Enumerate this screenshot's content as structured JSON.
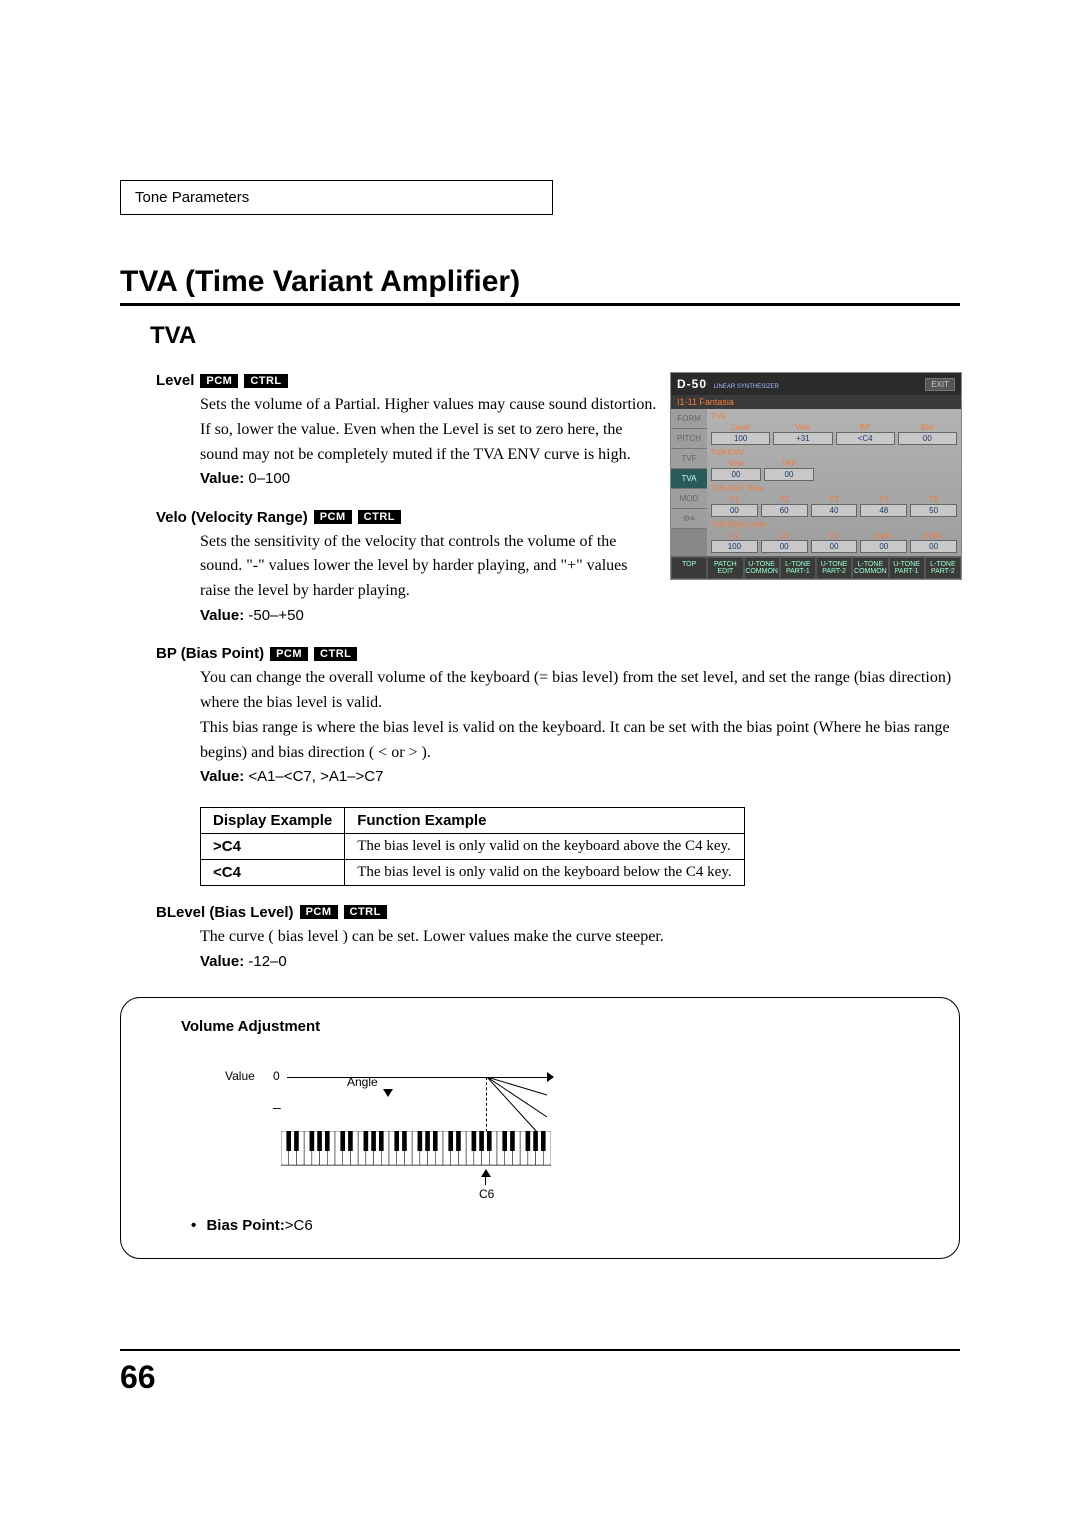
{
  "header": {
    "section": "Tone Parameters"
  },
  "title": "TVA (Time Variant Amplifier)",
  "subtitle": "TVA",
  "tags": {
    "pcm": "PCM",
    "ctrl": "CTRL"
  },
  "level": {
    "label": "Level",
    "desc": "Sets the volume of a Partial. Higher values may cause sound distortion. If so, lower the value. Even when the Level is set to zero here, the sound may not be completely muted if the TVA ENV curve is high.",
    "value_label": "Value:",
    "value": "0–100"
  },
  "velo": {
    "label": "Velo (Velocity Range)",
    "desc": "Sets the sensitivity of the velocity that controls the volume of the sound. \"-\" values lower the level by harder playing, and \"+\" values raise the level by harder playing.",
    "value_label": "Value:",
    "value": "-50–+50"
  },
  "bp": {
    "label": "BP (Bias Point)",
    "desc1": "You can change the overall volume of the keyboard (= bias level) from the set level, and set the range (bias direction) where the bias level is valid.",
    "desc2": "This bias range is where the bias level is valid on the keyboard. It can be set with the bias point (Where he bias range begins) and bias direction ( < or > ).",
    "value_label": "Value:",
    "value": "<A1–<C7, >A1–>C7"
  },
  "table": {
    "head1": "Display Example",
    "head2": "Function Example",
    "rows": [
      {
        "disp": ">C4",
        "func": "The bias level is only valid on the keyboard above the C4 key."
      },
      {
        "disp": "<C4",
        "func": "The bias level is only valid on the keyboard below the C4 key."
      }
    ]
  },
  "blevel": {
    "label": "BLevel (Bias Level)",
    "desc": "The curve ( bias level ) can be set. Lower values make the curve steeper.",
    "value_label": "Value:",
    "value": "-12–0"
  },
  "vol_box": {
    "heading": "Volume Adjustment",
    "value_label": "Value",
    "zero": "0",
    "minus": "–",
    "angle": "Angle",
    "c6": "C6",
    "bias_label": "Bias Point:",
    "bias_value": ">C6"
  },
  "screenshot": {
    "logo": "D-50",
    "logo_sub": "LINEAR SYNTHESIZER",
    "exit": "EXIT",
    "patch_title": "I1-11 Fantasia",
    "side": [
      "FORM",
      "PITCH",
      "TVF",
      "TVA",
      "MOD",
      "⚙≡"
    ],
    "active_side": "TVA",
    "sections": [
      {
        "title": "TVA",
        "cells": [
          {
            "label": "Level",
            "val": "100"
          },
          {
            "label": "Velo",
            "val": "+31"
          },
          {
            "label": "BP",
            "val": "<C4"
          },
          {
            "label": "Blvl",
            "val": "00"
          }
        ]
      },
      {
        "title": "TVA ENV",
        "cells": [
          {
            "label": "Velo",
            "val": "00"
          },
          {
            "label": "TKF",
            "val": "00"
          }
        ]
      },
      {
        "title": "TVA ENV Time",
        "cells": [
          {
            "label": "T1",
            "val": "00"
          },
          {
            "label": "T2",
            "val": "60"
          },
          {
            "label": "T3",
            "val": "40"
          },
          {
            "label": "T4",
            "val": "48"
          },
          {
            "label": "T5",
            "val": "50"
          }
        ]
      },
      {
        "title": "TVA ENV Level",
        "cells": [
          {
            "label": "L1",
            "val": "100"
          },
          {
            "label": "L2",
            "val": "00"
          },
          {
            "label": "L3",
            "val": "00"
          },
          {
            "label": "SusL",
            "val": "00"
          },
          {
            "label": "EndL",
            "val": "00"
          }
        ]
      }
    ],
    "bottom": [
      "TOP",
      "PATCH EDIT",
      "U-TONE COMMON",
      "L-TONE PART-1",
      "U-TONE PART-2",
      "L-TONE COMMON",
      "U-TONE PART-1",
      "L-TONE PART-2"
    ]
  },
  "page_number": "66"
}
